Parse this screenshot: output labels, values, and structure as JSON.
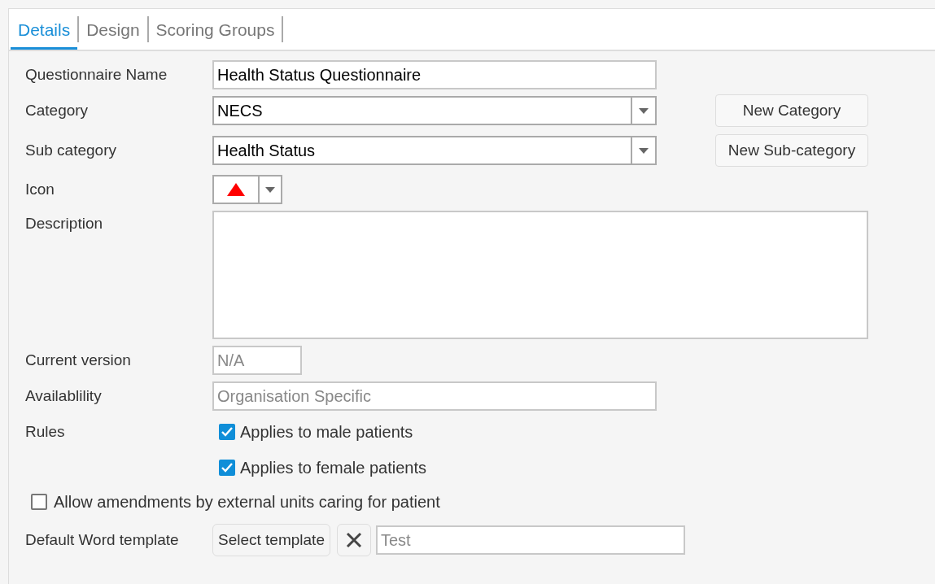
{
  "tabs": [
    {
      "label": "Details",
      "selected": true
    },
    {
      "label": "Design",
      "selected": false
    },
    {
      "label": "Scoring Groups",
      "selected": false
    }
  ],
  "questionnaire_name": {
    "label": "Questionnaire Name",
    "value": "Health Status Questionnaire"
  },
  "category": {
    "label": "Category",
    "value": "NECS",
    "button": "New Category"
  },
  "sub_category": {
    "label": "Sub category",
    "value": "Health Status",
    "button": "New Sub-category"
  },
  "icon": {
    "label": "Icon"
  },
  "description": {
    "label": "Description"
  },
  "current_version": {
    "label": "Current version",
    "value": "N/A",
    "disabled": true
  },
  "availability": {
    "label": "Availablility",
    "value": "Organisation Specific",
    "disabled": true
  },
  "rules": {
    "label": "Rules",
    "options": [
      {
        "label": "Applies to male patients",
        "checked": true
      },
      {
        "label": "Applies to female patients",
        "checked": true
      }
    ]
  },
  "allow_amendments": {
    "label": "Allow amendments by external units caring for patient",
    "checked": false
  },
  "word_template": {
    "label": "Default Word template",
    "button": "Select template",
    "value": "Test",
    "disabled": true
  }
}
